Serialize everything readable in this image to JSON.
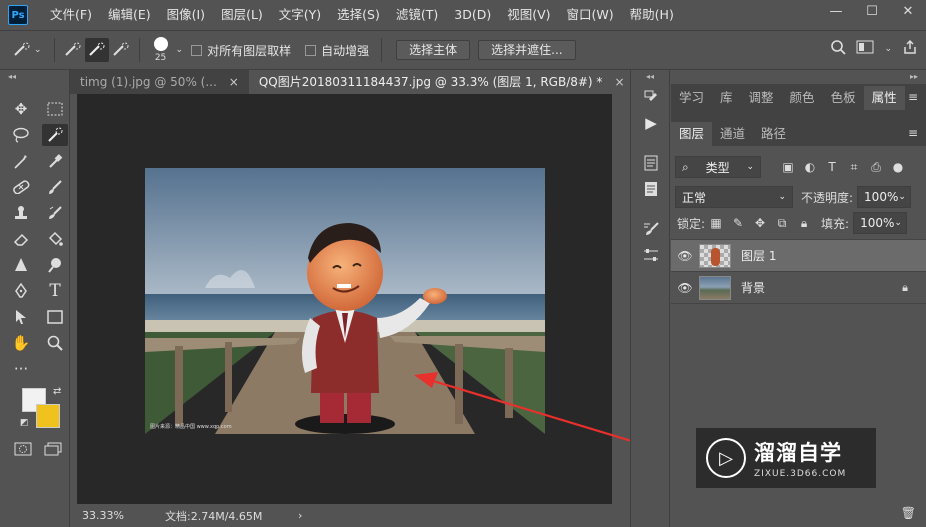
{
  "app": {
    "logo": "Ps"
  },
  "menu": [
    "文件(F)",
    "编辑(E)",
    "图像(I)",
    "图层(L)",
    "文字(Y)",
    "选择(S)",
    "滤镜(T)",
    "3D(D)",
    "视图(V)",
    "窗口(W)",
    "帮助(H)"
  ],
  "window_controls": {
    "minimize": "—",
    "maximize": "☐",
    "close": "✕"
  },
  "options": {
    "brush_size": "25",
    "sample_all_layers": "对所有图层取样",
    "auto_enhance": "自动增强",
    "select_subject": "选择主体",
    "select_mask": "选择并遮住..."
  },
  "tabs": [
    {
      "label": "timg (1).jpg @ 50% (...",
      "close": "×"
    },
    {
      "label": "QQ图片20180311184437.jpg @ 33.3% (图层 1, RGB/8#) *",
      "close": "×"
    }
  ],
  "status": {
    "zoom": "33.33%",
    "doc_size": "文档:2.74M/4.65M",
    "arrow": "›"
  },
  "colors": {
    "foreground": "#f2f2f2",
    "background": "#f0c21e",
    "accent_arrow": "#e8302c"
  },
  "image_caption": "图片来源：精品中国 www.xqp.com",
  "right_panel": {
    "top_tabs": [
      "学习",
      "库",
      "调整",
      "颜色",
      "色板",
      "属性"
    ],
    "layer_tabs": [
      "图层",
      "通道",
      "路径"
    ],
    "filter_type": "类型",
    "blend_mode": "正常",
    "opacity_label": "不透明度:",
    "opacity_value": "100%",
    "lock_label": "锁定:",
    "fill_label": "填充:",
    "fill_value": "100%",
    "layers": [
      {
        "name": "图层 1",
        "selected": true
      },
      {
        "name": "背景",
        "selected": false,
        "locked": true
      }
    ]
  },
  "watermark": {
    "title": "溜溜自学",
    "url": "ZIXUE.3D66.COM"
  }
}
